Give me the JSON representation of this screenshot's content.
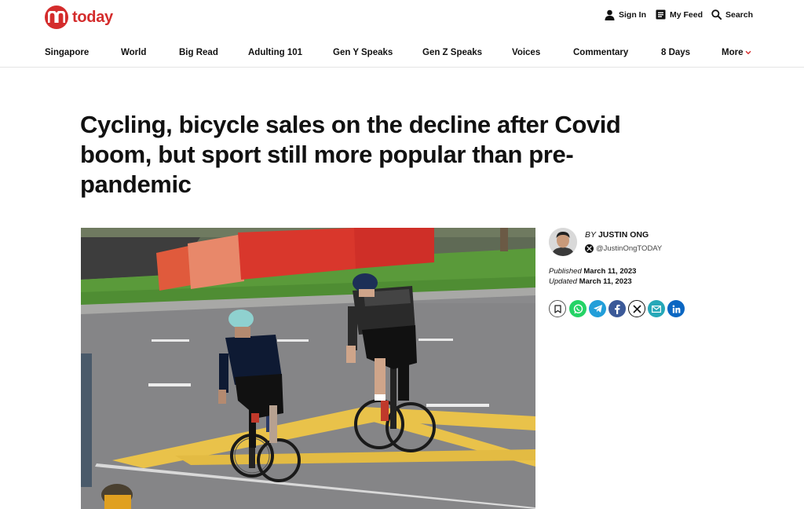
{
  "brand": {
    "name": "today",
    "color": "#d42c2c",
    "logo_icon": "mediacorp-m-logo"
  },
  "header": {
    "sign_in": "Sign In",
    "my_feed": "My Feed",
    "search": "Search"
  },
  "nav": {
    "items": [
      {
        "label": "Singapore"
      },
      {
        "label": "World"
      },
      {
        "label": "Big Read"
      },
      {
        "label": "Adulting 101"
      },
      {
        "label": "Gen Y Speaks"
      },
      {
        "label": "Gen Z Speaks"
      },
      {
        "label": "Voices"
      },
      {
        "label": "Commentary"
      },
      {
        "label": "8 Days"
      }
    ],
    "more": "More"
  },
  "article": {
    "headline": "Cycling, bicycle sales on the decline after Covid boom, but sport still more popular than pre-pandemic",
    "hero_image": "two-cyclists-on-road-photo"
  },
  "byline": {
    "by_label": "BY",
    "author": "JUSTIN ONG",
    "handle": "@JustinOngTODAY",
    "published_label": "Published",
    "published_date": "March 11, 2023",
    "updated_label": "Updated",
    "updated_date": "March 11, 2023"
  },
  "share": {
    "icons": [
      "bookmark-icon",
      "whatsapp-icon",
      "telegram-icon",
      "facebook-icon",
      "x-icon",
      "email-icon",
      "linkedin-icon"
    ],
    "colors": {
      "whatsapp": "#25d366",
      "telegram": "#229ed9",
      "facebook": "#3b5998",
      "x": "#111111",
      "email": "#26a8b8",
      "linkedin": "#0a66c2"
    }
  }
}
